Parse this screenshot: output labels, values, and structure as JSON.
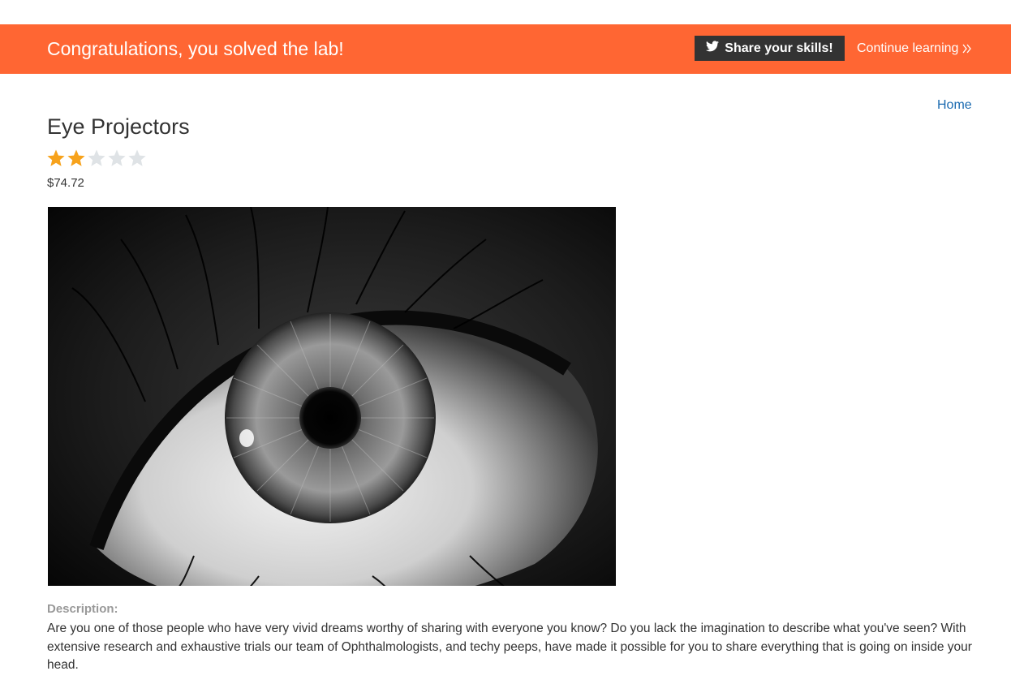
{
  "banner": {
    "title": "Congratulations, you solved the lab!",
    "share_label": "Share your skills!",
    "continue_label": "Continue learning",
    "background_color": "#ff6633",
    "share_icon": "twitter-icon",
    "continue_icon": "double-chevron-right-icon"
  },
  "nav": {
    "home_label": "Home"
  },
  "product": {
    "title": "Eye Projectors",
    "rating": 2,
    "rating_max": 5,
    "price": "$74.72",
    "image": "eye-closeup-image",
    "description_label": "Description:",
    "description": "Are you one of those people who have very vivid dreams worthy of sharing with everyone you know? Do you lack the imagination to describe what you've seen? With extensive research and exhaustive trials our team of Ophthalmologists, and techy peeps, have made it possible for you to share everything that is going on inside your head."
  },
  "colors": {
    "star_filled": "#f7a21b",
    "star_empty": "#dfe3e6",
    "link": "#1a6ab0"
  }
}
